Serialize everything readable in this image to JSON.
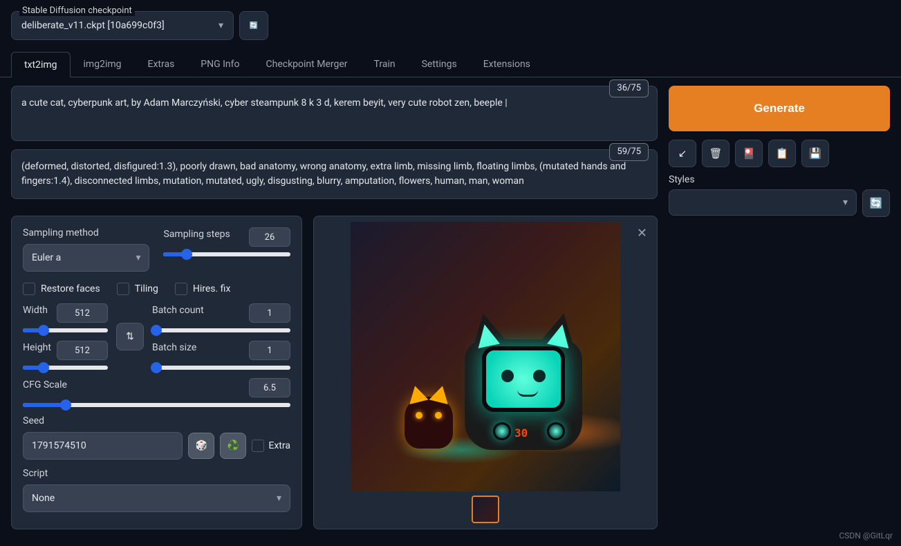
{
  "checkpoint": {
    "label": "Stable Diffusion checkpoint",
    "value": "deliberate_v11.ckpt [10a699c0f3]"
  },
  "tabs": [
    "txt2img",
    "img2img",
    "Extras",
    "PNG Info",
    "Checkpoint Merger",
    "Train",
    "Settings",
    "Extensions"
  ],
  "active_tab": "txt2img",
  "prompt": {
    "text": "a cute cat, cyberpunk art, by Adam Marczyński, cyber steampunk 8 k 3 d, kerem beyit, very cute robot zen, beeple |",
    "counter": "36/75"
  },
  "neg_prompt": {
    "text": "(deformed, distorted, disfigured:1.3), poorly drawn, bad anatomy, wrong anatomy, extra limb, missing limb, floating limbs, (mutated hands and fingers:1.4), disconnected limbs, mutation, mutated, ugly, disgusting, blurry, amputation, flowers, human, man, woman",
    "counter": "59/75"
  },
  "generate_label": "Generate",
  "styles_label": "Styles",
  "sampling": {
    "method_label": "Sampling method",
    "method_value": "Euler a",
    "steps_label": "Sampling steps",
    "steps_value": "26"
  },
  "checks": {
    "restore_faces": "Restore faces",
    "tiling": "Tiling",
    "hires_fix": "Hires. fix"
  },
  "dims": {
    "width_label": "Width",
    "width_value": "512",
    "height_label": "Height",
    "height_value": "512"
  },
  "batch": {
    "count_label": "Batch count",
    "count_value": "1",
    "size_label": "Batch size",
    "size_value": "1"
  },
  "cfg": {
    "label": "CFG Scale",
    "value": "6.5"
  },
  "seed": {
    "label": "Seed",
    "value": "1791574510",
    "extra_label": "Extra"
  },
  "script": {
    "label": "Script",
    "value": "None"
  },
  "watermark": "CSDN @GitLqr",
  "image_number": "30"
}
